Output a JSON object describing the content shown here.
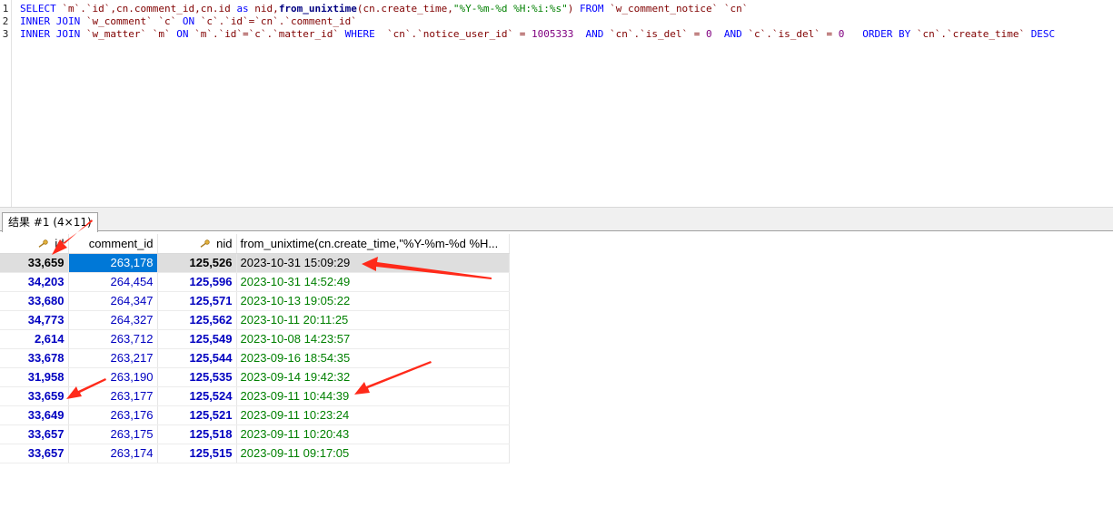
{
  "editor": {
    "line_numbers": [
      "1",
      "2",
      "3"
    ],
    "line1": {
      "select": "SELECT",
      "a": " `m`.`id`,cn.comment_id,cn.id ",
      "as": "as",
      "b": " nid,",
      "fn": "from_unixtime",
      "c": "(cn.create_time,",
      "str": "\"%Y-%m-%d %H:%i:%s\"",
      "d": ") ",
      "from": "FROM",
      "e": " `w_comment_notice` `cn`"
    },
    "line2": {
      "inner": "INNER JOIN",
      "a": " `w_comment` `c` ",
      "on": "ON",
      "b": " `c`.`id`=`cn`.`comment_id`"
    },
    "line3": {
      "inner": "INNER JOIN",
      "a": " `w_matter` `m` ",
      "on": "ON",
      "b": " `m`.`id`=`c`.`matter_id` ",
      "where": "WHERE",
      "c": "  `cn`.`notice_user_id` = ",
      "n1": "1005333",
      "and1": "  AND",
      "d": " `cn`.`is_del` = ",
      "n2": "0",
      "and2": "  AND",
      "e": " `c`.`is_del` = ",
      "n3": "0",
      "order": "   ORDER BY",
      "f": " `cn`.`create_time` ",
      "desc": "DESC"
    }
  },
  "result_tab": {
    "label": "结果 #1 (4×11)"
  },
  "grid": {
    "columns": [
      "id",
      "comment_id",
      "nid",
      "from_unixtime(cn.create_time,\"%Y-%m-%d %H..."
    ],
    "rows": [
      [
        "33,659",
        "263,178",
        "125,526",
        "2023-10-31 15:09:29"
      ],
      [
        "34,203",
        "264,454",
        "125,596",
        "2023-10-31 14:52:49"
      ],
      [
        "33,680",
        "264,347",
        "125,571",
        "2023-10-13 19:05:22"
      ],
      [
        "34,773",
        "264,327",
        "125,562",
        "2023-10-11 20:11:25"
      ],
      [
        "2,614",
        "263,712",
        "125,549",
        "2023-10-08 14:23:57"
      ],
      [
        "33,678",
        "263,217",
        "125,544",
        "2023-09-16 18:54:35"
      ],
      [
        "31,958",
        "263,190",
        "125,535",
        "2023-09-14 19:42:32"
      ],
      [
        "33,659",
        "263,177",
        "125,524",
        "2023-09-11 10:44:39"
      ],
      [
        "33,649",
        "263,176",
        "125,521",
        "2023-09-11 10:23:24"
      ],
      [
        "33,657",
        "263,175",
        "125,518",
        "2023-09-11 10:20:43"
      ],
      [
        "33,657",
        "263,174",
        "125,515",
        "2023-09-11 09:17:05"
      ]
    ],
    "selected_row": 0
  },
  "colors": {
    "keyword": "#0000ff",
    "string": "#008000",
    "number_literal": "#800080",
    "id_text": "#0000c0",
    "time_text": "#008000",
    "selection": "#0078d7",
    "arrow": "#ff2a1a"
  },
  "icons": {
    "key_column": "key-icon"
  }
}
